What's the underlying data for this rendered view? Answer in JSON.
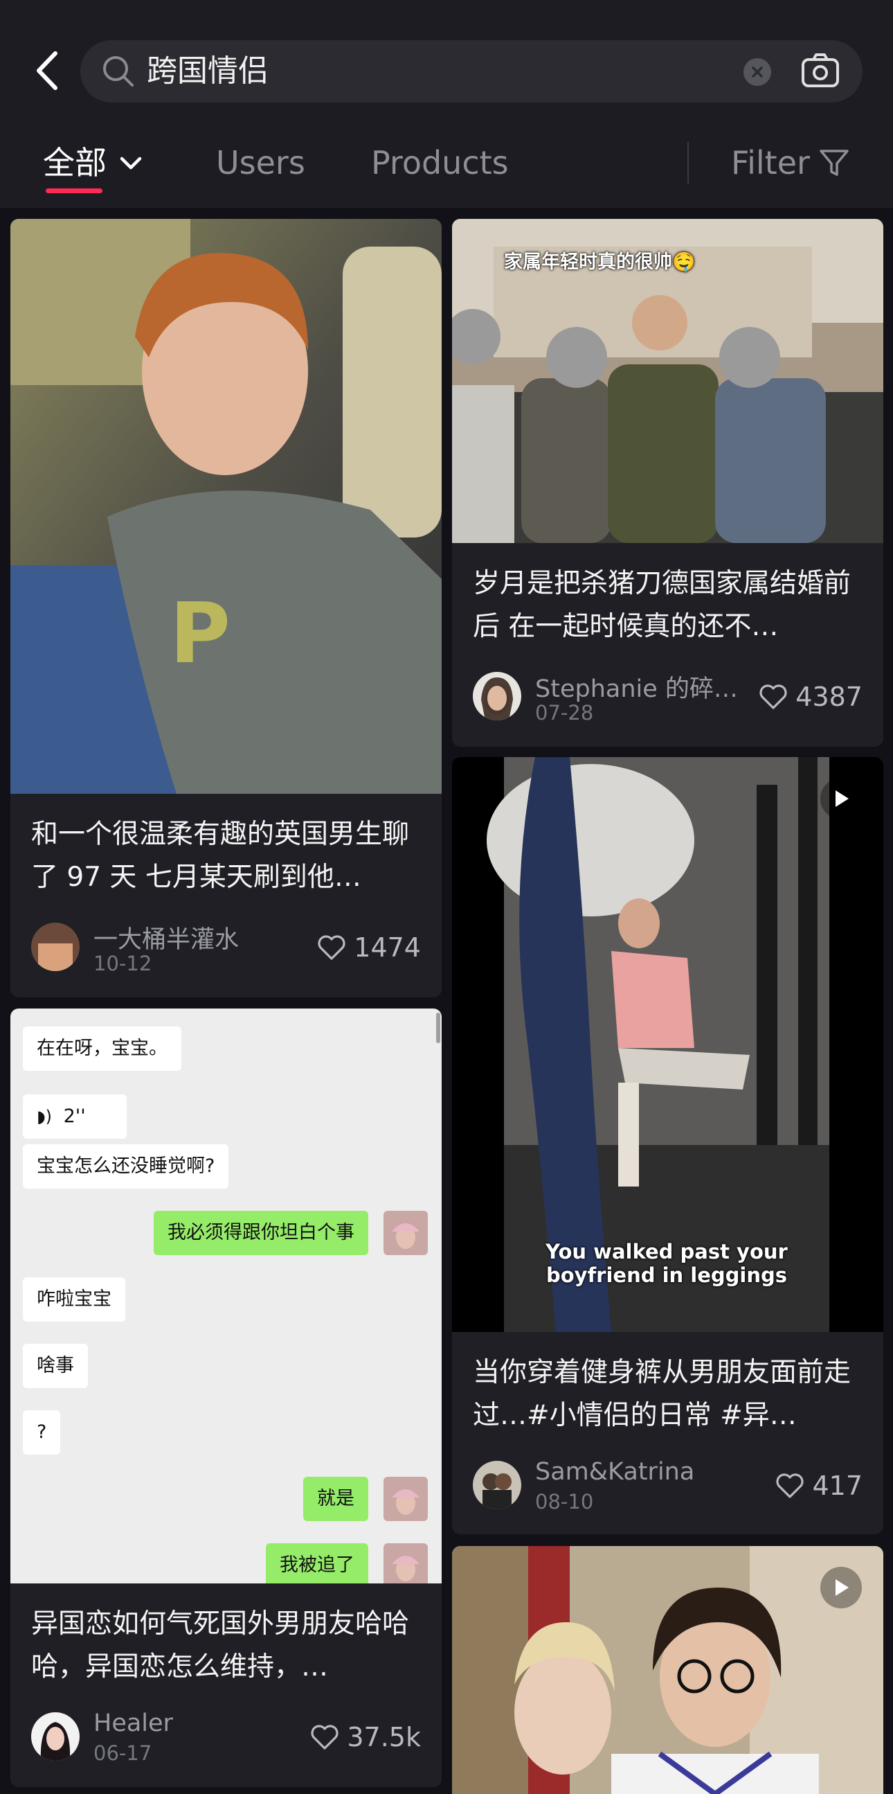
{
  "search": {
    "query": "跨国情侣"
  },
  "tabs": {
    "all": "全部",
    "users": "Users",
    "products": "Products",
    "filter": "Filter"
  },
  "posts": [
    {
      "title": "和一个很温柔有趣的英国男生聊了 97 天 七月某天刷到他…",
      "author": "一大桶半灌水",
      "date": "10-12",
      "likes": "1474"
    },
    {
      "title": "岁月是把杀猪刀德国家属结婚前后 在一起时候真的还不…",
      "author": "Stephanie 的碎…",
      "date": "07-28",
      "likes": "4387",
      "image_caption": "家属年轻时真的很帅🤤"
    },
    {
      "title": "当你穿着健身裤从男朋友面前走过…#小情侣的日常 #异…",
      "author": "Sam&Katrina",
      "date": "08-10",
      "likes": "417",
      "image_caption": "You walked past your boyfriend in leggings"
    },
    {
      "title": "异国恋如何气死国外男朋友哈哈哈，异国恋怎么维持，…",
      "author": "Healer",
      "date": "06-17",
      "likes": "37.5k",
      "chat": [
        {
          "text": "在在呀，宝宝。",
          "from": "them"
        },
        {
          "text": "2''",
          "from": "them",
          "voice": true
        },
        {
          "text": "宝宝怎么还没睡觉啊?",
          "from": "them"
        },
        {
          "text": "我必须得跟你坦白个事",
          "from": "me"
        },
        {
          "text": "咋啦宝宝",
          "from": "them"
        },
        {
          "text": "啥事",
          "from": "them"
        },
        {
          "text": "?",
          "from": "them"
        },
        {
          "text": "就是",
          "from": "me"
        },
        {
          "text": "我被追了",
          "from": "me"
        }
      ]
    }
  ],
  "colors": {
    "accent": "#fe2c55",
    "background": "#111117",
    "card": "#1f1f25",
    "chat_me_bubble": "#95ec69"
  }
}
